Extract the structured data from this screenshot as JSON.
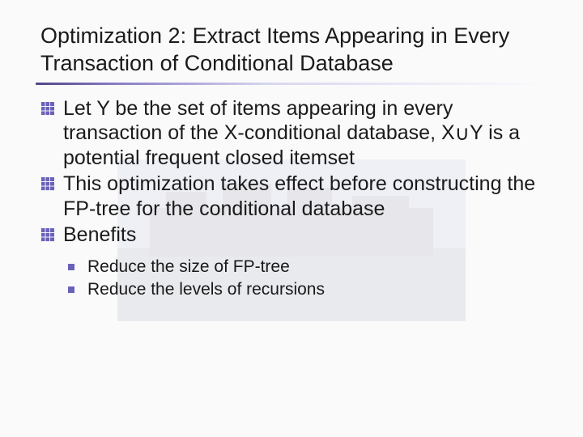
{
  "title": "Optimization 2: Extract Items Appearing in Every Transaction of Conditional Database",
  "bullets": {
    "b1_pre": "Let Y be the set of items appearing in every transaction of the X-conditional database, X",
    "b1_sym": "∪",
    "b1_post": "Y is a potential frequent closed itemset",
    "b2": "This optimization takes effect before constructing the FP-tree for the conditional database",
    "b3": "Benefits"
  },
  "sub": {
    "s1": "Reduce the size of FP-tree",
    "s2": "Reduce the levels of recursions"
  }
}
